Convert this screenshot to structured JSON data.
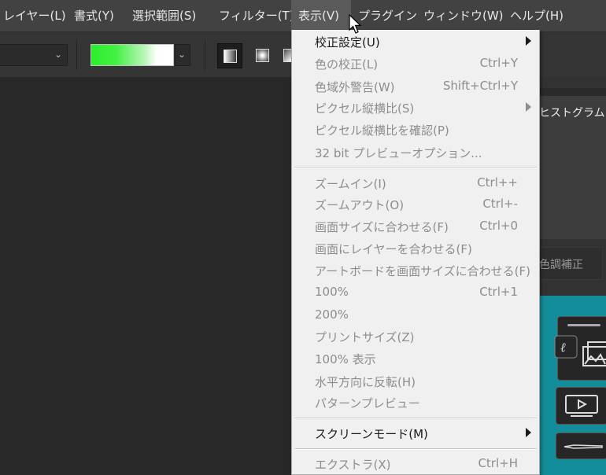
{
  "menubar": {
    "items": [
      {
        "label": "レイヤー(L)"
      },
      {
        "label": "書式(Y)"
      },
      {
        "label": "選択範囲(S)"
      },
      {
        "label": "フィルター(T)"
      },
      {
        "label": "表示(V)"
      },
      {
        "label": "プラグイン"
      },
      {
        "label": "ウィンドウ(W)"
      },
      {
        "label": "ヘルプ(H)"
      }
    ]
  },
  "options_bar": {
    "gradient_colors": [
      "#2dee2d",
      "#ffffff"
    ],
    "gradient_types": [
      "linear-gradient-icon",
      "radial-gradient-icon",
      "angle-gradient-icon"
    ]
  },
  "panels": {
    "histogram_tab": "ヒストグラム",
    "adjustments_tab": "色調補正",
    "accent_color": "#138d99"
  },
  "view_menu": {
    "items": [
      {
        "label": "校正設定(U)",
        "shortcut": "",
        "state": "enabled",
        "submenu": true
      },
      {
        "label": "色の校正(L)",
        "shortcut": "Ctrl+Y",
        "state": "disabled",
        "submenu": false
      },
      {
        "label": "色域外警告(W)",
        "shortcut": "Shift+Ctrl+Y",
        "state": "disabled",
        "submenu": false
      },
      {
        "label": "ピクセル縦横比(S)",
        "shortcut": "",
        "state": "disabled",
        "submenu": true
      },
      {
        "label": "ピクセル縦横比を確認(P)",
        "shortcut": "",
        "state": "disabled",
        "submenu": false
      },
      {
        "label": "32 bit プレビューオプション...",
        "shortcut": "",
        "state": "disabled",
        "submenu": false
      },
      {
        "label": "ズームイン(I)",
        "shortcut": "Ctrl++",
        "state": "disabled",
        "submenu": false
      },
      {
        "label": "ズームアウト(O)",
        "shortcut": "Ctrl+-",
        "state": "disabled",
        "submenu": false
      },
      {
        "label": "画面サイズに合わせる(F)",
        "shortcut": "Ctrl+0",
        "state": "disabled",
        "submenu": false
      },
      {
        "label": "画面にレイヤーを合わせる(F)",
        "shortcut": "",
        "state": "disabled",
        "submenu": false
      },
      {
        "label": "アートボードを画面サイズに合わせる(F)",
        "shortcut": "",
        "state": "disabled",
        "submenu": false
      },
      {
        "label": "100%",
        "shortcut": "Ctrl+1",
        "state": "disabled",
        "submenu": false
      },
      {
        "label": "200%",
        "shortcut": "",
        "state": "disabled",
        "submenu": false
      },
      {
        "label": "プリントサイズ(Z)",
        "shortcut": "",
        "state": "disabled",
        "submenu": false
      },
      {
        "label": "100% 表示",
        "shortcut": "",
        "state": "disabled",
        "submenu": false
      },
      {
        "label": "水平方向に反転(H)",
        "shortcut": "",
        "state": "disabled",
        "submenu": false
      },
      {
        "label": "パターンプレビュー",
        "shortcut": "",
        "state": "disabled",
        "submenu": false
      },
      {
        "label": "スクリーンモード(M)",
        "shortcut": "",
        "state": "enabled",
        "submenu": true
      },
      {
        "label": "エクストラ(X)",
        "shortcut": "Ctrl+H",
        "state": "disabled",
        "submenu": false
      }
    ]
  }
}
